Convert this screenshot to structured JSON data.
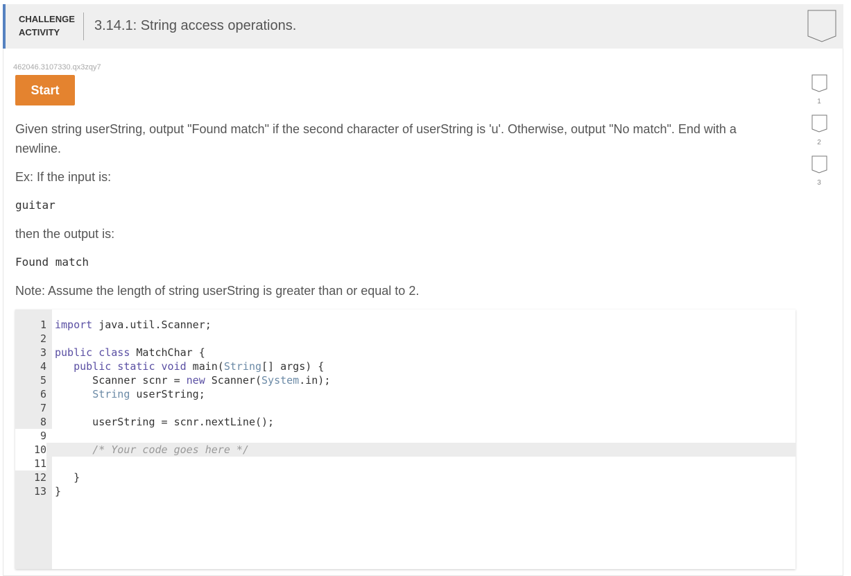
{
  "header": {
    "label_line1": "CHALLENGE",
    "label_line2": "ACTIVITY",
    "title": "3.14.1: String access operations."
  },
  "activity_id": "462046.3107330.qx3zqy7",
  "start_button": "Start",
  "instructions": {
    "p1": "Given string userString, output \"Found match\" if the second character of userString is 'u'. Otherwise, output \"No match\". End with a",
    "p1b": "newline.",
    "p2": "Ex: If the input is:",
    "input_example": "guitar",
    "p3": "then the output is:",
    "output_example": "Found match",
    "p4": "Note: Assume the length of string userString is greater than or equal to 2."
  },
  "steps": [
    "1",
    "2",
    "3"
  ],
  "code_lines": [
    "1",
    "2",
    "3",
    "4",
    "5",
    "6",
    "7",
    "8",
    "9",
    "10",
    "11",
    "12",
    "13"
  ]
}
